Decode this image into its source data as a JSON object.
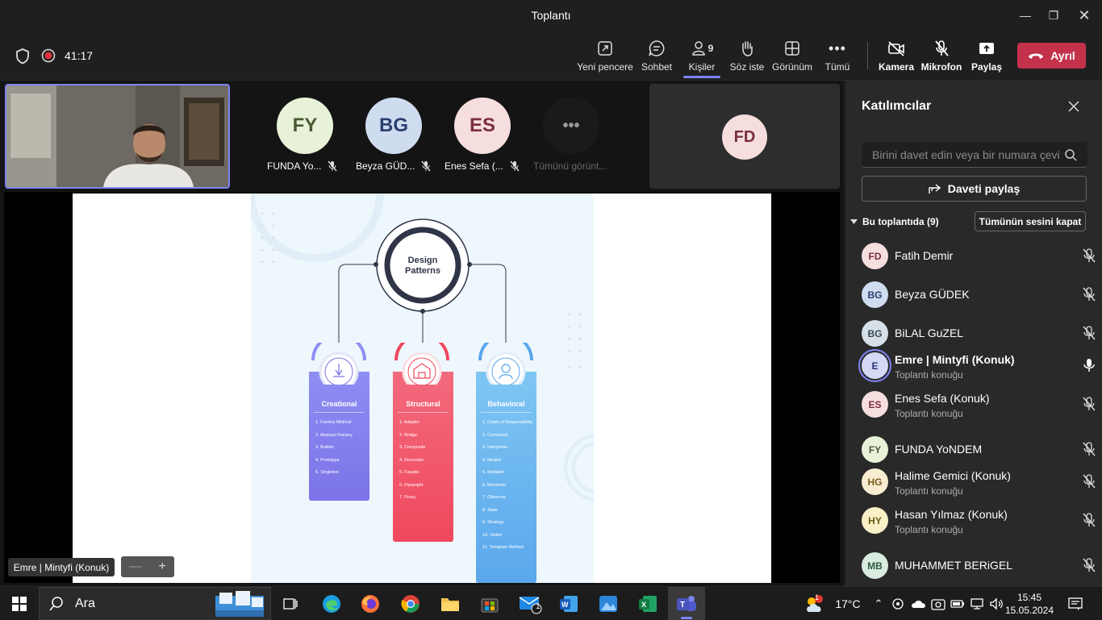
{
  "window": {
    "title": "Toplantı"
  },
  "meeting": {
    "timer": "41:17"
  },
  "toolbar": {
    "new_window": "Yeni pencere",
    "chat": "Sohbet",
    "people": "Kişiler",
    "people_count": "9",
    "raise_hand": "Söz iste",
    "view": "Görünüm",
    "more": "Tümü",
    "camera": "Kamera",
    "mic": "Mikrofon",
    "share": "Paylaş",
    "leave": "Ayrıl"
  },
  "gallery": {
    "tiles": [
      {
        "initials": "FY",
        "name": "FUNDA Yo...",
        "bg": "#e8f2d9",
        "fg": "#4a5a32"
      },
      {
        "initials": "BG",
        "name": "Beyza GÜD...",
        "bg": "#cfdcf0",
        "fg": "#2b3f6e"
      },
      {
        "initials": "ES",
        "name": "Enes Sefa (...",
        "bg": "#f6dede",
        "fg": "#7a2f3b"
      }
    ],
    "more_label": "Tümünü görünt...",
    "side_tile_initials": "FD"
  },
  "presenter": {
    "name": "Emre | Mintyfi (Konuk)"
  },
  "slide": {
    "center_title_1": "Design",
    "center_title_2": "Patterns",
    "columns": [
      {
        "title": "Creational",
        "items": [
          "1. Factory Method",
          "2. Abstract Factory",
          "3. Builder",
          "4. Prototype",
          "5. Singleton"
        ]
      },
      {
        "title": "Structural",
        "items": [
          "1. Adapter",
          "2. Bridge",
          "3. Composite",
          "4. Decorator",
          "5. Façade",
          "6. Flyweight",
          "7. Proxy"
        ]
      },
      {
        "title": "Behavioral",
        "items": [
          "1. Chain of Responsibility",
          "2. Command",
          "3. Interpreter",
          "4. Iterator",
          "5. Mediator",
          "6. Memento",
          "7. Observer",
          "8. State",
          "9. Strategy",
          "10. Visitor",
          "11. Template Method"
        ]
      }
    ]
  },
  "panel": {
    "title": "Katılımcılar",
    "invite_placeholder": "Birini davet edin veya bir numara çevirin",
    "share_invite": "Daveti paylaş",
    "section_label": "Bu toplantıda (9)",
    "mute_all": "Tümünün sesini kapat",
    "participants": [
      {
        "initials": "FD",
        "name": "Fatih Demir",
        "sub": "",
        "bg": "#f6dede",
        "fg": "#7a2f3b"
      },
      {
        "initials": "BG",
        "name": "Beyza GÜDEK",
        "sub": "",
        "bg": "#cfdcf0",
        "fg": "#2b3f6e"
      },
      {
        "initials": "BG",
        "name": "BiLAL GuZEL",
        "sub": "",
        "bg": "#d7e0e6",
        "fg": "#34495a"
      },
      {
        "initials": "E",
        "name": "Emre | Mintyfi (Konuk)",
        "sub": "Toplantı konuğu",
        "bg": "#d4d9f5",
        "fg": "#2c3470"
      },
      {
        "initials": "ES",
        "name": "Enes Sefa (Konuk)",
        "sub": "Toplantı konuğu",
        "bg": "#f6dede",
        "fg": "#7a2f3b"
      },
      {
        "initials": "FY",
        "name": "FUNDA YoNDEM",
        "sub": "",
        "bg": "#e8f2d9",
        "fg": "#4a5a32"
      },
      {
        "initials": "HG",
        "name": "Halime Gemici (Konuk)",
        "sub": "Toplantı konuğu",
        "bg": "#f8ecd2",
        "fg": "#7a5a1c"
      },
      {
        "initials": "HY",
        "name": "Hasan Yılmaz (Konuk)",
        "sub": "Toplantı konuğu",
        "bg": "#f9f0c8",
        "fg": "#6b5a12"
      },
      {
        "initials": "MB",
        "name": "MUHAMMET BERiGEL",
        "sub": "",
        "bg": "#d8ecdf",
        "fg": "#2f5a3e"
      }
    ]
  },
  "taskbar": {
    "search": "Ara",
    "temperature": "17°C",
    "time": "15:45",
    "date": "15.05.2024",
    "mail_badge": "1",
    "weather_badge": "1"
  }
}
